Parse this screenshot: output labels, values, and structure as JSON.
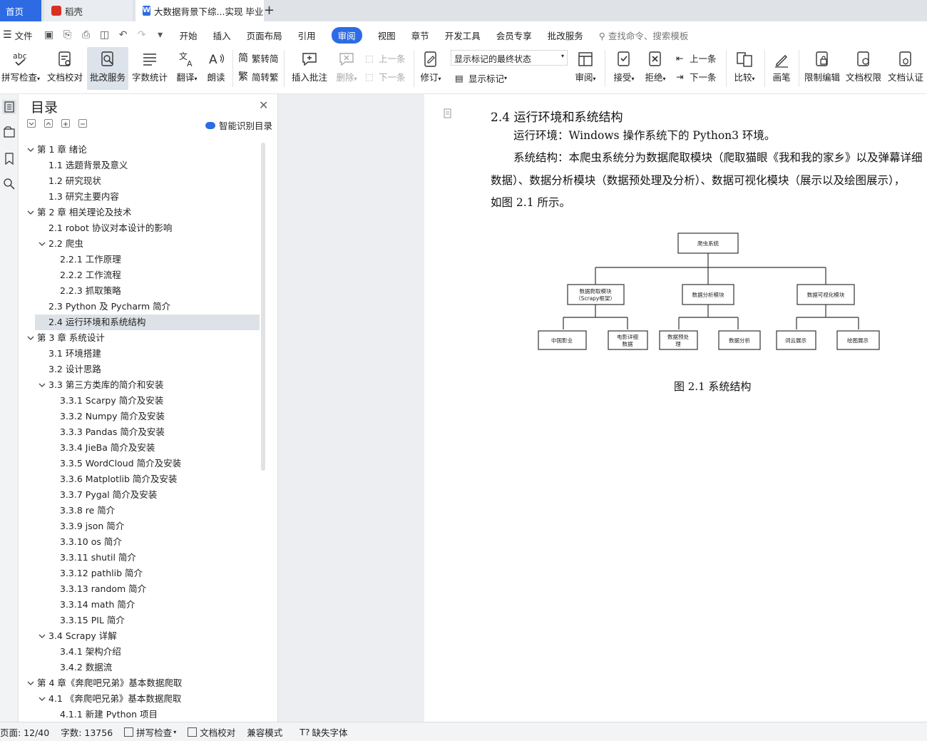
{
  "tabs": {
    "home": "首页",
    "daoke": "稻壳",
    "document": "大数据背景下综...实现 毕业论"
  },
  "menu": [
    "文件",
    "开始",
    "插入",
    "页面布局",
    "引用",
    "审阅",
    "视图",
    "章节",
    "开发工具",
    "会员专享",
    "批改服务"
  ],
  "menu_active": "审阅",
  "search_command": "查找命令、搜索模板",
  "ribbon": {
    "spell_check": "拼写检查",
    "doc_proof": "文档校对",
    "review_service": "批改服务",
    "word_count": "字数统计",
    "translate": "翻译",
    "read_aloud": "朗读",
    "trad_to_simp": "繁转简",
    "simp_to_trad": "简转繁",
    "insert_comment": "插入批注",
    "delete": "删除",
    "prev_comment": "上一条",
    "next_comment": "下一条",
    "revise": "修订",
    "markup_state": "显示标记的最终状态",
    "show_markup": "显示标记",
    "review": "审阅",
    "accept": "接受",
    "reject": "拒绝",
    "prev_change": "上一条",
    "next_change": "下一条",
    "compare": "比较",
    "pen": "画笔",
    "restrict_edit": "限制编辑",
    "doc_permission": "文档权限",
    "doc_cert": "文档认证"
  },
  "toc": {
    "title": "目录",
    "smart_recognize": "智能识别目录",
    "items": [
      {
        "text": "第 1 章  绪论",
        "level": 0,
        "arrow": true
      },
      {
        "text": "1.1  选题背景及意义",
        "level": 1,
        "arrow": false
      },
      {
        "text": "1.2  研究现状",
        "level": 1,
        "arrow": false
      },
      {
        "text": "1.3  研究主要内容",
        "level": 1,
        "arrow": false
      },
      {
        "text": "第 2 章  相关理论及技术",
        "level": 0,
        "arrow": true
      },
      {
        "text": "2.1 robot 协议对本设计的影响",
        "level": 1,
        "arrow": false
      },
      {
        "text": "2.2  爬虫",
        "level": 1,
        "arrow": true
      },
      {
        "text": "2.2.1  工作原理",
        "level": 2,
        "arrow": false
      },
      {
        "text": "2.2.2  工作流程",
        "level": 2,
        "arrow": false
      },
      {
        "text": "2.2.3  抓取策略",
        "level": 2,
        "arrow": false
      },
      {
        "text": "2.3 Python 及 Pycharm 简介",
        "level": 1,
        "arrow": false
      },
      {
        "text": "2.4 运行环境和系统结构",
        "level": 1,
        "arrow": false,
        "selected": true
      },
      {
        "text": "第 3 章  系统设计",
        "level": 0,
        "arrow": true
      },
      {
        "text": "3.1 环境搭建",
        "level": 1,
        "arrow": false
      },
      {
        "text": "3.2 设计思路",
        "level": 1,
        "arrow": false
      },
      {
        "text": "3.3  第三方类库的简介和安装",
        "level": 1,
        "arrow": true
      },
      {
        "text": "3.3.1 Scarpy 简介及安装",
        "level": 2,
        "arrow": false
      },
      {
        "text": "3.3.2 Numpy 简介及安装",
        "level": 2,
        "arrow": false
      },
      {
        "text": "3.3.3 Pandas 简介及安装",
        "level": 2,
        "arrow": false
      },
      {
        "text": "3.3.4 JieBa 简介及安装",
        "level": 2,
        "arrow": false
      },
      {
        "text": "3.3.5 WordCloud 简介及安装",
        "level": 2,
        "arrow": false
      },
      {
        "text": "3.3.6 Matplotlib 简介及安装",
        "level": 2,
        "arrow": false
      },
      {
        "text": "3.3.7 Pygal 简介及安装",
        "level": 2,
        "arrow": false
      },
      {
        "text": "3.3.8 re 简介",
        "level": 2,
        "arrow": false
      },
      {
        "text": "3.3.9 json 简介",
        "level": 2,
        "arrow": false
      },
      {
        "text": "3.3.10 os 简介",
        "level": 2,
        "arrow": false
      },
      {
        "text": "3.3.11 shutil 简介",
        "level": 2,
        "arrow": false
      },
      {
        "text": "3.3.12 pathlib 简介",
        "level": 2,
        "arrow": false
      },
      {
        "text": "3.3.13 random 简介",
        "level": 2,
        "arrow": false
      },
      {
        "text": "3.3.14 math 简介",
        "level": 2,
        "arrow": false
      },
      {
        "text": "3.3.15 PIL 简介",
        "level": 2,
        "arrow": false
      },
      {
        "text": "3.4 Scrapy 详解",
        "level": 1,
        "arrow": true
      },
      {
        "text": "3.4.1  架构介绍",
        "level": 2,
        "arrow": false
      },
      {
        "text": "3.4.2  数据流",
        "level": 2,
        "arrow": false
      },
      {
        "text": "第 4 章《奔爬吧兄弟》基本数据爬取",
        "level": 0,
        "arrow": true
      },
      {
        "text": "4.1  《奔爬吧兄弟》基本数据爬取",
        "level": 1,
        "arrow": true
      },
      {
        "text": "4.1.1  新建 Python 项目",
        "level": 2,
        "arrow": false
      }
    ]
  },
  "document": {
    "heading": "2.4 运行环境和系统结构",
    "para1": "运行环境：Windows 操作系统下的 Python3 环境。",
    "para2_line1": "系统结构：本爬虫系统分为数据爬取模块（爬取猫眼《我和我的家乡》以及弹幕详细",
    "para2_line2": "数据）、数据分析模块（数据预处理及分析）、数据可视化模块（展示以及绘图展示），",
    "para2_line3": "如图 2.1 所示。",
    "diagram": {
      "root": "爬虫系统",
      "module1_line1": "数据爬取模块",
      "module1_line2": "（Scrapy框架）",
      "module2": "数据分析模块",
      "module3": "数据可视化模块",
      "leaf1": "中国影业",
      "leaf2_line1": "电影详细",
      "leaf2_line2": "数据",
      "leaf3_line1": "数据预处",
      "leaf3_line2": "理",
      "leaf4": "数据分析",
      "leaf5": "词云展示",
      "leaf6": "绘图展示"
    },
    "caption": "图 2.1 系统结构"
  },
  "status": {
    "page": "页面: 12/40",
    "words": "字数: 13756",
    "spell": "拼写检查",
    "proof": "文档校对",
    "compat": "兼容模式",
    "missing_font": "缺失字体"
  },
  "colors": {
    "accent": "#2d6be4",
    "selected_row": "#dde2e8",
    "gray_area": "#eceef1"
  }
}
